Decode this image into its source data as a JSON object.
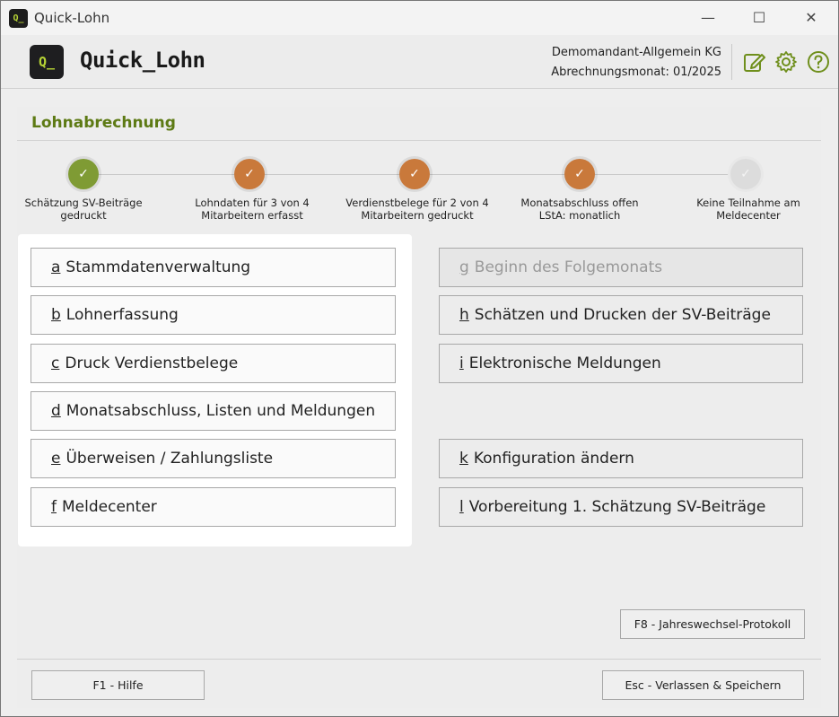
{
  "window": {
    "title": "Quick-Lohn",
    "app_icon_text": "Q_",
    "min_glyph": "—",
    "max_glyph": "☐",
    "close_glyph": "✕"
  },
  "header": {
    "logo_text": "Q_",
    "app_name": "Quick_Lohn",
    "company": "Demomandant-Allgemein KG",
    "month": "Abrechnungsmonat: 01/2025",
    "icons": [
      "edit-icon",
      "gear-icon",
      "help-icon"
    ],
    "accent_color": "#6f8f1c"
  },
  "section": {
    "title": "Lohnabrechnung"
  },
  "steps": [
    {
      "label": "Schätzung SV-Beiträge gedruckt",
      "status": "done",
      "color": "#7f9b34",
      "check": "✓"
    },
    {
      "label": "Lohndaten für 3 von 4 Mitarbeitern erfasst",
      "status": "partial",
      "color": "#c9793b",
      "check": "✓"
    },
    {
      "label": "Verdienstbelege für 2 von 4 Mitarbeitern gedruckt",
      "status": "partial",
      "color": "#c9793b",
      "check": "✓"
    },
    {
      "label": "Monatsabschluss offen LStA: monatlich",
      "status": "partial",
      "color": "#c9793b",
      "check": "✓"
    },
    {
      "label": "Keine Teilnahme am Meldecenter",
      "status": "inactive",
      "color": "#dcdcdc",
      "check": "✓"
    }
  ],
  "left_buttons": [
    {
      "key": "a",
      "label": "Stammdatenverwaltung"
    },
    {
      "key": "b",
      "label": "Lohnerfassung"
    },
    {
      "key": "c",
      "label": "Druck Verdienstbelege"
    },
    {
      "key": "d",
      "label": "Monatsabschluss, Listen und Meldungen"
    },
    {
      "key": "e",
      "label": "Überweisen / Zahlungsliste"
    },
    {
      "key": "f",
      "label": "Meldecenter"
    }
  ],
  "right_buttons": [
    {
      "key": "g",
      "label": "Beginn des Folgemonats",
      "enabled": false
    },
    {
      "key": "h",
      "label": "Schätzen und Drucken der SV-Beiträge",
      "enabled": true
    },
    {
      "key": "i",
      "label": "Elektronische Meldungen",
      "enabled": true
    },
    {
      "key": "k",
      "label": "Konfiguration ändern",
      "enabled": true
    },
    {
      "key": "l",
      "label": "Vorbereitung 1. Schätzung SV-Beiträge",
      "enabled": true
    }
  ],
  "protocol_button": "F8 - Jahreswechsel-Protokoll",
  "footer": {
    "help_button": "F1 - Hilfe",
    "exit_button": "Esc - Verlassen & Speichern"
  }
}
